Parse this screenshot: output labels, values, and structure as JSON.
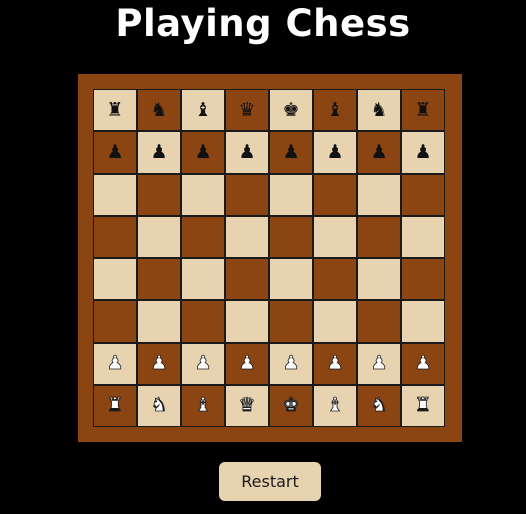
{
  "page": {
    "title": "Playing Chess"
  },
  "colors": {
    "background": "#000000",
    "frame": "#8b4513",
    "light_square": "#e8d3b0",
    "dark_square": "#8b4513",
    "button": "#e8d3b0"
  },
  "board": {
    "rows": [
      [
        {
          "glyph": "♜",
          "icon": "black-rook-icon",
          "side": "black"
        },
        {
          "glyph": "♞",
          "icon": "black-knight-icon",
          "side": "black"
        },
        {
          "glyph": "♝",
          "icon": "black-bishop-icon",
          "side": "black"
        },
        {
          "glyph": "♛",
          "icon": "black-queen-icon",
          "side": "black"
        },
        {
          "glyph": "♚",
          "icon": "black-king-icon",
          "side": "black"
        },
        {
          "glyph": "♝",
          "icon": "black-bishop-icon",
          "side": "black"
        },
        {
          "glyph": "♞",
          "icon": "black-knight-icon",
          "side": "black"
        },
        {
          "glyph": "♜",
          "icon": "black-rook-icon",
          "side": "black"
        }
      ],
      [
        {
          "glyph": "♟",
          "icon": "black-pawn-icon",
          "side": "black"
        },
        {
          "glyph": "♟",
          "icon": "black-pawn-icon",
          "side": "black"
        },
        {
          "glyph": "♟",
          "icon": "black-pawn-icon",
          "side": "black"
        },
        {
          "glyph": "♟",
          "icon": "black-pawn-icon",
          "side": "black"
        },
        {
          "glyph": "♟",
          "icon": "black-pawn-icon",
          "side": "black"
        },
        {
          "glyph": "♟",
          "icon": "black-pawn-icon",
          "side": "black"
        },
        {
          "glyph": "♟",
          "icon": "black-pawn-icon",
          "side": "black"
        },
        {
          "glyph": "♟",
          "icon": "black-pawn-icon",
          "side": "black"
        }
      ],
      [
        null,
        null,
        null,
        null,
        null,
        null,
        null,
        null
      ],
      [
        null,
        null,
        null,
        null,
        null,
        null,
        null,
        null
      ],
      [
        null,
        null,
        null,
        null,
        null,
        null,
        null,
        null
      ],
      [
        null,
        null,
        null,
        null,
        null,
        null,
        null,
        null
      ],
      [
        {
          "glyph": "♟",
          "icon": "white-pawn-icon",
          "side": "white"
        },
        {
          "glyph": "♟",
          "icon": "white-pawn-icon",
          "side": "white"
        },
        {
          "glyph": "♟",
          "icon": "white-pawn-icon",
          "side": "white"
        },
        {
          "glyph": "♟",
          "icon": "white-pawn-icon",
          "side": "white"
        },
        {
          "glyph": "♟",
          "icon": "white-pawn-icon",
          "side": "white"
        },
        {
          "glyph": "♟",
          "icon": "white-pawn-icon",
          "side": "white"
        },
        {
          "glyph": "♟",
          "icon": "white-pawn-icon",
          "side": "white"
        },
        {
          "glyph": "♟",
          "icon": "white-pawn-icon",
          "side": "white"
        }
      ],
      [
        {
          "glyph": "♜",
          "icon": "white-rook-icon",
          "side": "white"
        },
        {
          "glyph": "♞",
          "icon": "white-knight-icon",
          "side": "white"
        },
        {
          "glyph": "♝",
          "icon": "white-bishop-icon",
          "side": "white"
        },
        {
          "glyph": "♛",
          "icon": "white-queen-icon",
          "side": "white"
        },
        {
          "glyph": "♚",
          "icon": "white-king-icon",
          "side": "white"
        },
        {
          "glyph": "♝",
          "icon": "white-bishop-icon",
          "side": "white"
        },
        {
          "glyph": "♞",
          "icon": "white-knight-icon",
          "side": "white"
        },
        {
          "glyph": "♜",
          "icon": "white-rook-icon",
          "side": "white"
        }
      ]
    ]
  },
  "controls": {
    "restart_label": "Restart"
  }
}
